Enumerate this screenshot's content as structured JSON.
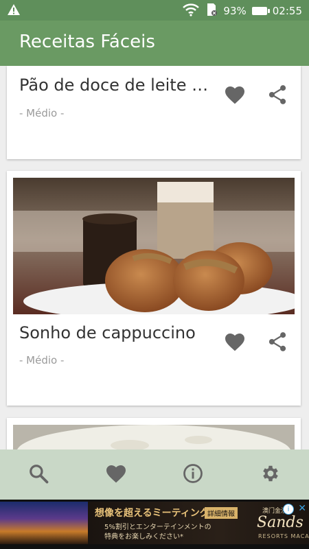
{
  "status_bar": {
    "battery": "93%",
    "time": "02:55",
    "icons": [
      "warning-icon",
      "wifi-icon",
      "sd-card-icon",
      "battery-icon"
    ]
  },
  "app_bar": {
    "title": "Receitas Fáceis"
  },
  "recipes": [
    {
      "title": "Pão de doce de leite do ...",
      "difficulty": "- Médio -"
    },
    {
      "title": "Sonho de cappuccino",
      "difficulty": "- Médio -"
    }
  ],
  "bottom_nav": {
    "items": [
      "search-icon",
      "favorite-heart-icon",
      "info-icon",
      "settings-gear-icon"
    ]
  },
  "ad": {
    "headline": "想像を超えるミーティング",
    "button": "詳細情報",
    "line1": "5%割引とエンターテインメントの",
    "line2": "特典をお楽しみください*",
    "brand_top": "澳门金沙",
    "brand": "Sands",
    "brand_sub": "RESORTS MACAO"
  },
  "colors": {
    "status_bar": "#5f8f5b",
    "app_bar": "#6a9a63",
    "bottom_nav": "#c9d8c7",
    "icon_gray": "#666666"
  }
}
